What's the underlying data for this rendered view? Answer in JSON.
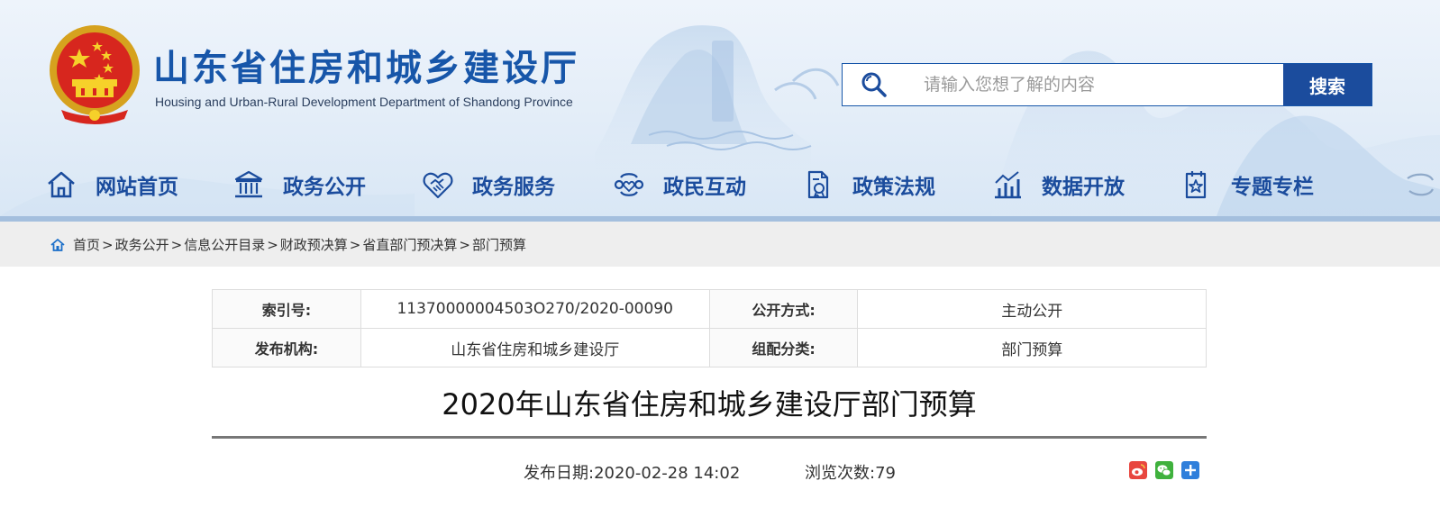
{
  "header": {
    "site_title": "山东省住房和城乡建设厅",
    "site_subtitle": "Housing and Urban-Rural Development Department of Shandong Province",
    "brand_color": "#1756a9",
    "search": {
      "placeholder": "请输入您想了解的内容",
      "button_label": "搜索"
    }
  },
  "nav": {
    "items": [
      {
        "label": "网站首页",
        "icon": "home-icon"
      },
      {
        "label": "政务公开",
        "icon": "government-building-icon"
      },
      {
        "label": "政务服务",
        "icon": "handshake-heart-icon"
      },
      {
        "label": "政民互动",
        "icon": "interaction-icon"
      },
      {
        "label": "政策法规",
        "icon": "policy-document-icon"
      },
      {
        "label": "数据开放",
        "icon": "bar-chart-icon"
      },
      {
        "label": "专题专栏",
        "icon": "star-badge-icon"
      }
    ]
  },
  "breadcrumb": {
    "items": [
      "首页",
      "政务公开",
      "信息公开目录",
      "财政预决算",
      "省直部门预决算",
      "部门预算"
    ],
    "separator": ">"
  },
  "meta": {
    "index_label": "索引号:",
    "index_value": "11370000004503O270/2020-00090",
    "method_label": "公开方式:",
    "method_value": "主动公开",
    "publisher_label": "发布机构:",
    "publisher_value": "山东省住房和城乡建设厅",
    "category_label": "组配分类:",
    "category_value": "部门预算"
  },
  "article": {
    "title": "2020年山东省住房和城乡建设厅部门预算",
    "publish_date": "发布日期:2020-02-28 14:02",
    "views": "浏览次数:79"
  },
  "share": {
    "icons": [
      "weibo-icon",
      "wechat-icon",
      "plus-share-icon"
    ]
  }
}
